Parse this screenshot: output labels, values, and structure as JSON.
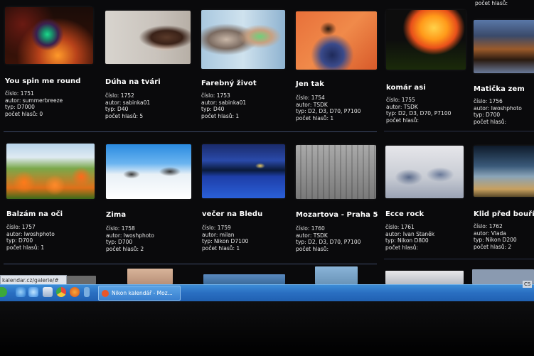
{
  "gallery": {
    "row1": [
      {
        "title": "You spin me round",
        "cislo": "číslo: 1751",
        "autor": "autor: summerbreeze",
        "typ": "typ: D7000",
        "hlasu": "počet hlasů: 0"
      },
      {
        "title": "Dúha na tvári",
        "cislo": "číslo: 1752",
        "autor": "autor: sabinka01",
        "typ": "typ: D40",
        "hlasu": "počet hlasů: 5"
      },
      {
        "title": "Farebný život",
        "cislo": "číslo: 1753",
        "autor": "autor: sabinka01",
        "typ": "typ: D40",
        "hlasu": "počet hlasů: 1"
      },
      {
        "title": "Jen tak",
        "cislo": "číslo: 1754",
        "autor": "autor: TSDK",
        "typ": "typ: D2, D3, D70, P7100",
        "hlasu": "počet hlasů: 1"
      },
      {
        "title": "komár asi",
        "cislo": "číslo: 1755",
        "autor": "autor: TSDK",
        "typ": "typ: D2, D3, D70, P7100",
        "hlasu": "počet hlasů:"
      },
      {
        "title": "Matička zem",
        "cislo": "číslo: 1756",
        "autor": "autor: lwoshphoto",
        "typ": "typ: D700",
        "hlasu": "počet hlasů:"
      }
    ],
    "row2": [
      {
        "title": "Balzám na oči",
        "cislo": "číslo: 1757",
        "autor": "autor: lwoshphoto",
        "typ": "typ: D700",
        "hlasu": "počet hlasů: 1"
      },
      {
        "title": "Zima",
        "cislo": "číslo: 1758",
        "autor": "autor: lwoshphoto",
        "typ": "typ: D700",
        "hlasu": "počet hlasů: 2"
      },
      {
        "title": "večer na Bledu",
        "cislo": "číslo: 1759",
        "autor": "autor: milan",
        "typ": "typ: Nikon D7100",
        "hlasu": "počet hlasů: 1"
      },
      {
        "title": "Mozartova - Praha 5",
        "cislo": "číslo: 1760",
        "autor": "autor: TSDK",
        "typ": "typ: D2, D3, D70, P7100",
        "hlasu": "počet hlasů:"
      },
      {
        "title": "Ecce rock",
        "cislo": "číslo: 1761",
        "autor": "autor: Ivan Staněk",
        "typ": "typ: Nikon D800",
        "hlasu": "počet hlasů:"
      },
      {
        "title": "Klid před bouří",
        "cislo": "číslo: 1762",
        "autor": "autor: Vlada",
        "typ": "typ: Nikon D200",
        "hlasu": "počet hlasů: 2"
      }
    ],
    "top_partial_text": "počet hlasů:"
  },
  "browser": {
    "status_url": "kalendar.cz/galerie/#"
  },
  "taskbar": {
    "task_label": "Nikon kalendář - Moz...",
    "tray_text": "CS"
  },
  "colors": {
    "separator": "#3d4a68",
    "taskbar": "#2a6fc2"
  }
}
